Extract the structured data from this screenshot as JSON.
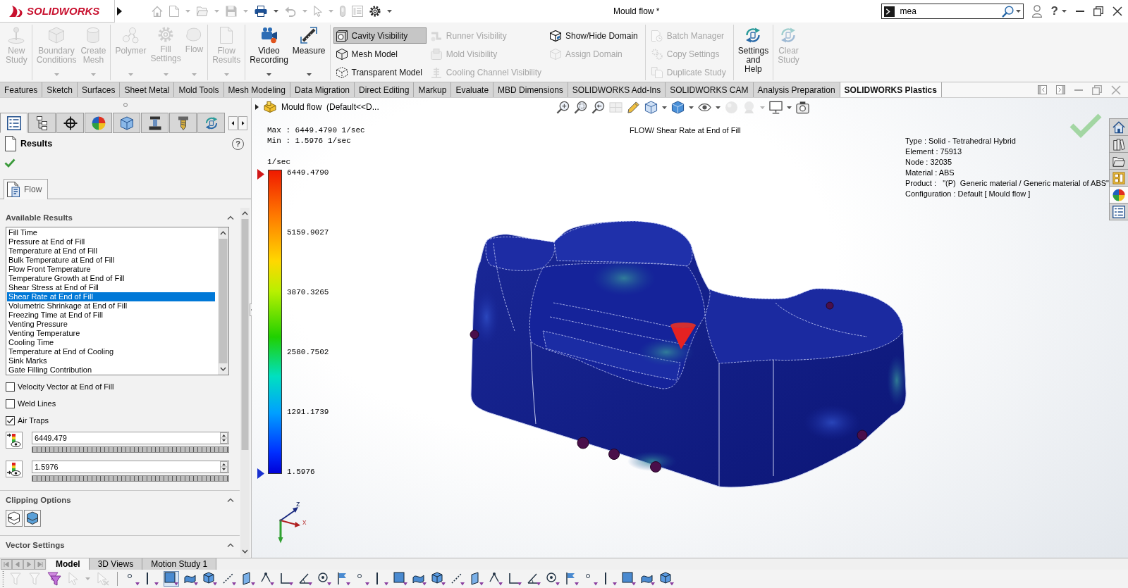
{
  "title_bar": {
    "logo": "SOLIDWORKS",
    "quick_access": [
      {
        "disabled": true,
        "dropdown": false
      },
      {
        "disabled": true,
        "dropdown": true
      },
      {
        "disabled": true,
        "dropdown": true
      },
      {
        "disabled": true,
        "dropdown": true
      },
      {
        "disabled": false,
        "dropdown": true
      },
      {
        "disabled": true,
        "dropdown": true
      },
      {
        "disabled": true,
        "dropdown": true
      },
      {
        "disabled": true,
        "dropdown": false
      },
      {
        "disabled": true,
        "dropdown": false
      },
      {
        "disabled": false,
        "dropdown": true
      }
    ],
    "title": "Mould flow *",
    "search": {
      "value": "mea"
    },
    "help": "?"
  },
  "ribbon": {
    "groups": [
      {
        "items": [
          {
            "kind": "large",
            "label": "New Study",
            "disabled": true,
            "dropdown": false
          }
        ]
      },
      {
        "items": [
          {
            "kind": "large",
            "label": "Boundary Conditions",
            "disabled": true,
            "dropdown": true
          },
          {
            "kind": "large",
            "label": "Create Mesh",
            "disabled": true,
            "dropdown": true
          }
        ]
      },
      {
        "items": [
          {
            "kind": "large",
            "label": "Polymer",
            "disabled": true,
            "dropdown": true
          },
          {
            "kind": "large",
            "label": "Fill Settings",
            "disabled": true,
            "dropdown": true
          },
          {
            "kind": "large",
            "label": "Flow",
            "disabled": true,
            "dropdown": true
          }
        ]
      },
      {
        "items": [
          {
            "kind": "large",
            "label": "Flow Results",
            "disabled": true,
            "dropdown": true
          }
        ]
      },
      {
        "items": [
          {
            "kind": "large",
            "label": "Video Recording",
            "disabled": false,
            "dropdown": true
          },
          {
            "kind": "large",
            "label": "Measure",
            "disabled": false,
            "dropdown": true
          }
        ]
      },
      {
        "items": [
          {
            "kind": "column",
            "buttons": [
              {
                "label": "Cavity Visibility",
                "selected": true,
                "disabled": false
              },
              {
                "label": "Mesh Model",
                "selected": false,
                "disabled": false
              },
              {
                "label": "Transparent Model",
                "selected": false,
                "disabled": false
              }
            ]
          },
          {
            "kind": "column",
            "buttons": [
              {
                "label": "Runner Visibility",
                "selected": false,
                "disabled": true
              },
              {
                "label": "Mold Visibility",
                "selected": false,
                "disabled": true
              },
              {
                "label": "Cooling Channel Visibility",
                "selected": false,
                "disabled": true
              }
            ]
          },
          {
            "kind": "column",
            "buttons": [
              {
                "label": "Show/Hide Domain",
                "selected": false,
                "disabled": false
              },
              {
                "label": "Assign Domain",
                "selected": false,
                "disabled": true
              }
            ]
          }
        ]
      },
      {
        "items": [
          {
            "kind": "column",
            "buttons": [
              {
                "label": "Batch Manager",
                "selected": false,
                "disabled": true
              },
              {
                "label": "Copy Settings",
                "selected": false,
                "disabled": true
              },
              {
                "label": "Duplicate Study",
                "selected": false,
                "disabled": true
              }
            ]
          }
        ]
      },
      {
        "items": [
          {
            "kind": "large",
            "label": "Settings and Help",
            "disabled": false,
            "dropdown": false
          }
        ]
      },
      {
        "items": [
          {
            "kind": "large",
            "label": "Clear Study",
            "disabled": true,
            "dropdown": false
          }
        ]
      }
    ]
  },
  "command_tabs": [
    {
      "label": "Features",
      "selected": false
    },
    {
      "label": "Sketch",
      "selected": false
    },
    {
      "label": "Surfaces",
      "selected": false
    },
    {
      "label": "Sheet Metal",
      "selected": false
    },
    {
      "label": "Mold Tools",
      "selected": false
    },
    {
      "label": "Mesh Modeling",
      "selected": false
    },
    {
      "label": "Data Migration",
      "selected": false
    },
    {
      "label": "Direct Editing",
      "selected": false
    },
    {
      "label": "Markup",
      "selected": false
    },
    {
      "label": "Evaluate",
      "selected": false
    },
    {
      "label": "MBD Dimensions",
      "selected": false
    },
    {
      "label": "SOLIDWORKS Add-Ins",
      "selected": false
    },
    {
      "label": "SOLIDWORKS CAM",
      "selected": false
    },
    {
      "label": "Analysis Preparation",
      "selected": false
    },
    {
      "label": "SOLIDWORKS Plastics",
      "selected": true
    }
  ],
  "property_manager": {
    "icon_tabs": [
      {
        "selected": true
      },
      {
        "selected": false
      },
      {
        "selected": false
      },
      {
        "selected": false
      },
      {
        "selected": false
      },
      {
        "selected": false
      },
      {
        "selected": false
      },
      {
        "selected": false
      }
    ],
    "title": "Results",
    "help": "?",
    "sub_tabs": [
      {
        "label": "Flow",
        "selected": true
      }
    ],
    "sections": [
      {
        "kind": "results",
        "title": "Available Results",
        "expanded": true,
        "results": [
          {
            "label": "Fill Time",
            "selected": false
          },
          {
            "label": "Pressure at End of Fill",
            "selected": false
          },
          {
            "label": "Temperature at End of Fill",
            "selected": false
          },
          {
            "label": "Bulk Temperature at End of Fill",
            "selected": false
          },
          {
            "label": "Flow Front Temperature",
            "selected": false
          },
          {
            "label": "Temperature Growth at End of Fill",
            "selected": false
          },
          {
            "label": "Shear Stress at End of Fill",
            "selected": false
          },
          {
            "label": "Shear Rate at End of Fill",
            "selected": true
          },
          {
            "label": "Volumetric Shrinkage at End of Fill",
            "selected": false
          },
          {
            "label": "Freezing Time at End of Fill",
            "selected": false
          },
          {
            "label": "Venting Pressure",
            "selected": false
          },
          {
            "label": "Venting Temperature",
            "selected": false
          },
          {
            "label": "Cooling Time",
            "selected": false
          },
          {
            "label": "Temperature at End of Cooling",
            "selected": false
          },
          {
            "label": "Sink Marks",
            "selected": false
          },
          {
            "label": "Gate Filling Contribution",
            "selected": false
          }
        ],
        "options": [
          {
            "label": "Velocity Vector at End of Fill",
            "checked": false
          },
          {
            "label": "Weld Lines",
            "checked": false
          },
          {
            "label": "Air Traps",
            "checked": true
          }
        ],
        "range": [
          {
            "kind": "max",
            "value": "6449.479"
          },
          {
            "kind": "min",
            "value": "1.5976"
          }
        ]
      },
      {
        "kind": "clipping",
        "title": "Clipping Options",
        "expanded": true
      },
      {
        "kind": "vector",
        "title": "Vector Settings",
        "expanded": true
      }
    ]
  },
  "viewport": {
    "breadcrumb": "Mould flow  (Default<<D...",
    "heads_up_toolbar": [
      {
        "disabled": false,
        "dropdown": false
      },
      {
        "disabled": false,
        "dropdown": false
      },
      {
        "disabled": false,
        "dropdown": false
      },
      {
        "disabled": true,
        "dropdown": false
      },
      {
        "disabled": false,
        "dropdown": false
      },
      {
        "disabled": false,
        "dropdown": true
      },
      {
        "disabled": false,
        "dropdown": true
      },
      {
        "disabled": false,
        "dropdown": true
      },
      {
        "disabled": true,
        "dropdown": false
      },
      {
        "disabled": true,
        "dropdown": true
      },
      {
        "disabled": false,
        "dropdown": true
      },
      {
        "disabled": false,
        "dropdown": false
      }
    ],
    "max_text": "Max : 6449.4790 1/sec",
    "min_text": "Min : 1.5976 1/sec",
    "plot_title": "FLOW/ Shear Rate at End of Fill",
    "legend": {
      "unit": "1/sec",
      "labels": [
        "6449.4790",
        "5159.9027",
        "3870.3265",
        "2580.7502",
        "1291.1739",
        "1.5976"
      ]
    },
    "model_info": [
      "Type : Solid - Tetrahedral Hybrid",
      "Element : 75913",
      "Node : 32035",
      "Material : ABS",
      "Product :   \"(P)  Generic material / Generic material of ABS\"",
      "Configuration : Default [ Mould flow ]"
    ],
    "task_pane": [
      {
        "selected": false
      },
      {
        "selected": false
      },
      {
        "selected": false
      },
      {
        "selected": false
      },
      {
        "selected": true
      },
      {
        "selected": false
      }
    ],
    "triad": {
      "labels": [
        "z",
        "x"
      ]
    }
  },
  "bottom_tabs": [
    {
      "label": "Model",
      "selected": true
    },
    {
      "label": "3D Views",
      "selected": false
    },
    {
      "label": "Motion Study 1",
      "selected": false
    }
  ],
  "bottom_toolbar": [
    {
      "disabled": true,
      "pressed": false,
      "dropdown": false
    },
    {
      "disabled": true,
      "pressed": false,
      "dropdown": false
    },
    {
      "disabled": false,
      "pressed": false,
      "dropdown": false
    },
    {
      "disabled": true,
      "pressed": false,
      "dropdown": true
    },
    {
      "disabled": true,
      "pressed": false,
      "dropdown": false
    },
    {
      "disabled": false,
      "pressed": false,
      "dropdown": false
    },
    {
      "disabled": false,
      "pressed": false,
      "dropdown": false
    },
    {
      "disabled": false,
      "pressed": true,
      "dropdown": false
    },
    {
      "disabled": false,
      "pressed": false,
      "dropdown": false
    },
    {
      "disabled": false,
      "pressed": false,
      "dropdown": false
    },
    {
      "disabled": false,
      "pressed": false,
      "dropdown": false
    },
    {
      "disabled": false,
      "pressed": false,
      "dropdown": false
    },
    {
      "disabled": false,
      "pressed": false,
      "dropdown": false
    },
    {
      "disabled": false,
      "pressed": false,
      "dropdown": false
    },
    {
      "disabled": false,
      "pressed": false,
      "dropdown": false
    },
    {
      "disabled": false,
      "pressed": false,
      "dropdown": false
    },
    {
      "disabled": false,
      "pressed": false,
      "dropdown": false
    },
    {
      "disabled": false,
      "pressed": false,
      "dropdown": false
    },
    {
      "disabled": false,
      "pressed": false,
      "dropdown": false
    },
    {
      "disabled": false,
      "pressed": false,
      "dropdown": false
    },
    {
      "disabled": false,
      "pressed": false,
      "dropdown": false
    },
    {
      "disabled": false,
      "pressed": false,
      "dropdown": false
    },
    {
      "disabled": false,
      "pressed": false,
      "dropdown": false
    },
    {
      "disabled": false,
      "pressed": false,
      "dropdown": false
    },
    {
      "disabled": false,
      "pressed": false,
      "dropdown": false
    },
    {
      "disabled": false,
      "pressed": false,
      "dropdown": false
    },
    {
      "disabled": false,
      "pressed": false,
      "dropdown": false
    },
    {
      "disabled": false,
      "pressed": false,
      "dropdown": false
    },
    {
      "disabled": false,
      "pressed": false,
      "dropdown": false
    },
    {
      "disabled": false,
      "pressed": false,
      "dropdown": false
    },
    {
      "disabled": false,
      "pressed": false,
      "dropdown": false
    },
    {
      "disabled": false,
      "pressed": false,
      "dropdown": false
    },
    {
      "disabled": false,
      "pressed": false,
      "dropdown": false
    },
    {
      "disabled": false,
      "pressed": false,
      "dropdown": false
    }
  ]
}
